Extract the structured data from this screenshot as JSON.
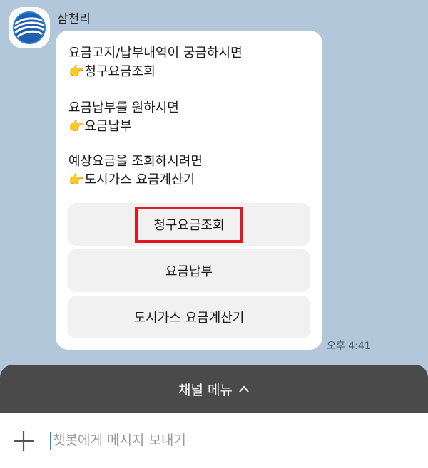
{
  "chat": {
    "sender_name": "삼천리",
    "messages": [
      {
        "text": "요금고지/납부내역이 궁금하시면"
      },
      {
        "emoji": "👉",
        "text": "청구요금조회"
      },
      {
        "text": "요금납부를 원하시면"
      },
      {
        "emoji": "👉",
        "text": "요금납부"
      },
      {
        "text": "예상요금을 조회하시려면"
      },
      {
        "emoji": "👉",
        "text": "도시가스 요금계산기"
      }
    ],
    "buttons": [
      "청구요금조회",
      "요금납부",
      "도시가스 요금계산기"
    ],
    "timestamp": "오후 4:41"
  },
  "menu": {
    "label": "채널 메뉴",
    "chevron": "^"
  },
  "composer": {
    "placeholder": "챗봇에게 메시지 보내기",
    "plus_icon": "plus-icon"
  },
  "colors": {
    "background": "#b2c7d9",
    "bubble": "#ffffff",
    "button": "#f1f1f1",
    "menu_bar": "#4a4a4a",
    "highlight": "#e0191e",
    "caret": "#1e88e5"
  }
}
